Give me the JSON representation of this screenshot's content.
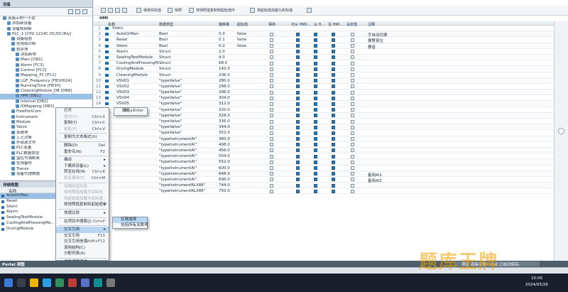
{
  "left_panel": {
    "title": "设备",
    "tree": [
      {
        "label": "连接示例一小试",
        "indent": 0
      },
      {
        "label": "添加新设备",
        "indent": 1
      },
      {
        "label": "设备和网络",
        "indent": 1
      },
      {
        "label": "PLC_1 [CPU 1214C DC/DC/Rly]",
        "indent": 1
      },
      {
        "label": "设备组态",
        "indent": 2
      },
      {
        "label": "在线和诊断",
        "indent": 2
      },
      {
        "label": "程序块",
        "indent": 2
      },
      {
        "label": "添加新块",
        "indent": 3
      },
      {
        "label": "Main [OB1]",
        "indent": 3
      },
      {
        "label": "Alarm [FC3]",
        "indent": 3
      },
      {
        "label": "Control [FC2]",
        "indent": 3
      },
      {
        "label": "Mapping_FC [FC1]",
        "indent": 3
      },
      {
        "label": "LGF_Frequency [FB10624]",
        "indent": 3
      },
      {
        "label": "RunningTime [FB30]",
        "indent": 3
      },
      {
        "label": "CleaningModule_DB [DB8]",
        "indent": 3
      },
      {
        "label": "HMI [DB1]",
        "indent": 3,
        "selected": true
      },
      {
        "label": "Interval [DB2]",
        "indent": 3
      },
      {
        "label": "IOMapping [DB3]",
        "indent": 3
      },
      {
        "label": "FreePortCom",
        "indent": 2
      },
      {
        "label": "Instrument",
        "indent": 2
      },
      {
        "label": "Module",
        "indent": 2
      },
      {
        "label": "Valve",
        "indent": 2
      },
      {
        "label": "系统块",
        "indent": 2
      },
      {
        "label": "工艺对象",
        "indent": 2
      },
      {
        "label": "外部源文件",
        "indent": 2
      },
      {
        "label": "PLC变量",
        "indent": 2
      },
      {
        "label": "PLC数据类型",
        "indent": 2
      },
      {
        "label": "监控与强制表",
        "indent": 2
      },
      {
        "label": "在线备份",
        "indent": 2
      },
      {
        "label": "Traces",
        "indent": 2
      },
      {
        "label": "设备代理数据",
        "indent": 2
      }
    ]
  },
  "detail_view": {
    "title": "详细视图",
    "column_header": "名称",
    "rows": [
      "AutoOrMan",
      "Reset",
      "Silent",
      "Alarm",
      "SealingTestModule",
      "CoolingAndPressingMe...",
      "DryingModule"
    ]
  },
  "toolbar": {
    "buttons": [
      "保持实际值",
      "快照",
      "将快照值复制到起始值中",
      "将起始值加载为实际值"
    ],
    "block_name": "HMI"
  },
  "grid": {
    "headers": [
      "名称",
      "数据类型",
      "偏移量",
      "起始值",
      "保持",
      "可从 HMI/...",
      "从 H...",
      "在 HMI...",
      "设定值",
      "注释"
    ],
    "rows": [
      {
        "n": "1",
        "name": "Static",
        "type": "",
        "offset": "",
        "start": "",
        "comment": "",
        "level": 0,
        "checks": [
          0,
          0,
          0,
          0,
          0
        ]
      },
      {
        "n": "2",
        "name": "AutoOrMan",
        "type": "Bool",
        "offset": "0.0",
        "start": "false",
        "comment": "手自动切换",
        "level": 1,
        "checks": [
          0,
          1,
          1,
          1,
          0
        ]
      },
      {
        "n": "3",
        "name": "Reset",
        "type": "Bool",
        "offset": "0.1",
        "start": "false",
        "comment": "报警复位",
        "level": 1,
        "checks": [
          0,
          1,
          1,
          1,
          0
        ]
      },
      {
        "n": "4",
        "name": "Silent",
        "type": "Bool",
        "offset": "0.2",
        "start": "false",
        "comment": "静音",
        "level": 1,
        "checks": [
          0,
          1,
          1,
          1,
          0
        ]
      },
      {
        "n": "5",
        "name": "Alarm",
        "type": "Struct",
        "offset": "2.0",
        "start": "",
        "comment": "",
        "level": 1,
        "checks": [
          0,
          1,
          1,
          1,
          0
        ]
      },
      {
        "n": "6",
        "name": "SealingTestModule",
        "type": "Struct",
        "offset": "4.0",
        "start": "",
        "comment": "",
        "level": 1,
        "checks": [
          0,
          1,
          1,
          1,
          0
        ]
      },
      {
        "n": "7",
        "name": "CoolingAndPressingM...",
        "type": "Struct",
        "offset": "68.0",
        "start": "",
        "comment": "",
        "level": 1,
        "checks": [
          0,
          1,
          1,
          1,
          0
        ]
      },
      {
        "n": "8",
        "name": "DryingModule",
        "type": "Struct",
        "offset": "142.0",
        "start": "",
        "comment": "",
        "level": 1,
        "checks": [
          0,
          1,
          1,
          1,
          0
        ]
      },
      {
        "n": "9",
        "name": "CleaningModule",
        "type": "Struct",
        "offset": "206.0",
        "start": "",
        "comment": "",
        "level": 1,
        "checks": [
          0,
          1,
          1,
          1,
          0
        ]
      },
      {
        "n": "10",
        "name": "VSV01",
        "type": "\"typeValve\"",
        "offset": "280.0",
        "start": "",
        "comment": "",
        "level": 1,
        "checks": [
          0,
          1,
          1,
          1,
          0
        ]
      },
      {
        "n": "11",
        "name": "VSV02",
        "type": "\"typeValve\"",
        "offset": "288.0",
        "start": "",
        "comment": "",
        "level": 1,
        "checks": [
          0,
          1,
          1,
          1,
          0
        ]
      },
      {
        "n": "12",
        "name": "VSV03",
        "type": "\"typeValve\"",
        "offset": "296.0",
        "start": "",
        "comment": "",
        "level": 1,
        "checks": [
          0,
          1,
          1,
          1,
          0
        ]
      },
      {
        "n": "13",
        "name": "VSV04",
        "type": "\"typeValve\"",
        "offset": "304.0",
        "start": "",
        "comment": "",
        "level": 1,
        "checks": [
          0,
          1,
          1,
          1,
          0
        ]
      },
      {
        "n": "14",
        "name": "VSV05",
        "type": "\"typeValve\"",
        "offset": "312.0",
        "start": "",
        "comment": "",
        "level": 1,
        "checks": [
          0,
          1,
          1,
          1,
          0
        ]
      },
      {
        "n": "15",
        "name": "",
        "type": "\"typeValve\"",
        "offset": "320.0",
        "start": "",
        "comment": "",
        "level": 1,
        "checks": [
          0,
          1,
          1,
          1,
          0
        ]
      },
      {
        "n": "16",
        "name": "",
        "type": "\"typeValve\"",
        "offset": "328.0",
        "start": "",
        "comment": "",
        "level": 1,
        "checks": [
          0,
          1,
          1,
          1,
          0
        ]
      },
      {
        "n": "17",
        "name": "",
        "type": "\"typeValve\"",
        "offset": "336.0",
        "start": "",
        "comment": "",
        "level": 1,
        "checks": [
          0,
          1,
          1,
          1,
          0
        ]
      },
      {
        "n": "18",
        "name": "",
        "type": "\"typeValve\"",
        "offset": "344.0",
        "start": "",
        "comment": "",
        "level": 1,
        "checks": [
          0,
          1,
          1,
          1,
          0
        ]
      },
      {
        "n": "19",
        "name": "",
        "type": "\"typeValve\"",
        "offset": "352.0",
        "start": "",
        "comment": "",
        "level": 1,
        "checks": [
          0,
          1,
          1,
          1,
          0
        ]
      },
      {
        "n": "20",
        "name": "",
        "type": "\"typeInstrumentAI\"",
        "offset": "360.0",
        "start": "",
        "comment": "",
        "level": 1,
        "checks": [
          0,
          1,
          1,
          1,
          0
        ]
      },
      {
        "n": "21",
        "name": "",
        "type": "\"typeInstrumentAI\"",
        "offset": "408.0",
        "start": "",
        "comment": "",
        "level": 1,
        "checks": [
          0,
          1,
          1,
          1,
          0
        ]
      },
      {
        "n": "22",
        "name": "",
        "type": "\"typeInstrumentAI\"",
        "offset": "456.0",
        "start": "",
        "comment": "",
        "level": 1,
        "checks": [
          0,
          1,
          1,
          1,
          0
        ]
      },
      {
        "n": "23",
        "name": "",
        "type": "\"typeInstrumentAI\"",
        "offset": "504.0",
        "start": "",
        "comment": "",
        "level": 1,
        "checks": [
          0,
          1,
          1,
          1,
          0
        ]
      },
      {
        "n": "24",
        "name": "",
        "type": "\"typeInstrumentAI\"",
        "offset": "552.0",
        "start": "",
        "comment": "",
        "level": 1,
        "checks": [
          0,
          1,
          1,
          1,
          0
        ]
      },
      {
        "n": "25",
        "name": "",
        "type": "\"typeInstrumentAI\"",
        "offset": "600.0",
        "start": "",
        "comment": "",
        "level": 1,
        "checks": [
          0,
          1,
          1,
          1,
          0
        ]
      },
      {
        "n": "26",
        "name": "",
        "type": "\"typeInstrumentAI\"",
        "offset": "648.0",
        "start": "",
        "comment": "备用AI1",
        "level": 1,
        "checks": [
          0,
          1,
          1,
          1,
          0
        ]
      },
      {
        "n": "27",
        "name": "",
        "type": "\"typeInstrumentAI\"",
        "offset": "696.0",
        "start": "",
        "comment": "备用AI2",
        "level": 1,
        "checks": [
          0,
          1,
          1,
          1,
          0
        ]
      },
      {
        "n": "28",
        "name": "",
        "type": "\"typeInstrumentRLX86\"",
        "offset": "744.0",
        "start": "",
        "comment": "",
        "level": 1,
        "checks": [
          0,
          1,
          1,
          1,
          0
        ]
      },
      {
        "n": "29",
        "name": "",
        "type": "\"typeInstrumentRLX86\"",
        "offset": "750.0",
        "start": "",
        "comment": "",
        "level": 1,
        "checks": [
          0,
          1,
          1,
          1,
          0
        ]
      }
    ]
  },
  "context_menu": {
    "items": [
      {
        "label": "打开",
        "shortcut": "",
        "disabled": false,
        "sep_after": false
      },
      {
        "label": "剪切(T)",
        "shortcut": "Ctrl+X",
        "disabled": true,
        "sep_after": false
      },
      {
        "label": "复制(Y)",
        "shortcut": "Ctrl+C",
        "disabled": false,
        "sep_after": false
      },
      {
        "label": "粘贴(P)",
        "shortcut": "Ctrl+V",
        "disabled": true,
        "sep_after": true
      },
      {
        "label": "复制为文本格式(X)",
        "shortcut": "",
        "disabled": false,
        "sep_after": true
      },
      {
        "label": "删除(D)",
        "shortcut": "Del",
        "disabled": false,
        "sep_after": false
      },
      {
        "label": "重命名(N)",
        "shortcut": "F2",
        "disabled": false,
        "sep_after": true
      },
      {
        "label": "编译",
        "shortcut": "",
        "disabled": false,
        "arrow": true,
        "sep_after": false
      },
      {
        "label": "下载到设备(L)",
        "shortcut": "",
        "disabled": false,
        "arrow": true,
        "sep_after": false
      },
      {
        "label": "转至在线(N)",
        "shortcut": "Ctrl+K",
        "disabled": false,
        "sep_after": false
      },
      {
        "label": "转至离线(F)",
        "shortcut": "Ctrl+M",
        "disabled": true,
        "sep_after": true
      },
      {
        "label": "快照的实际值",
        "shortcut": "",
        "disabled": true,
        "sep_after": false
      },
      {
        "label": "将快照值加载为实际值",
        "shortcut": "",
        "disabled": true,
        "sep_after": false
      },
      {
        "label": "将起始值加载为实际值",
        "shortcut": "",
        "disabled": true,
        "sep_after": false
      },
      {
        "label": "将快照值复制到起始值中",
        "shortcut": "",
        "disabled": false,
        "arrow": true,
        "sep_after": true
      },
      {
        "label": "快速比较",
        "shortcut": "",
        "disabled": false,
        "arrow": true,
        "sep_after": true
      },
      {
        "label": "在项目中搜索(J)",
        "shortcut": "Ctrl+F",
        "disabled": false,
        "sep_after": true
      },
      {
        "label": "交叉引用",
        "shortcut": "",
        "disabled": false,
        "selected": true,
        "arrow": true,
        "sep_after": false
      },
      {
        "label": "交叉引用",
        "shortcut": "F11",
        "disabled": false,
        "sep_after": false
      },
      {
        "label": "交叉引用信息",
        "shortcut": "Shift+F11",
        "disabled": false,
        "sep_after": false
      },
      {
        "label": "调用结构(C)",
        "shortcut": "",
        "disabled": false,
        "sep_after": false
      },
      {
        "label": "分配列表(A)",
        "shortcut": "",
        "disabled": false,
        "sep_after": true
      },
      {
        "label": "切换编程语言",
        "shortcut": "",
        "disabled": false,
        "arrow": true,
        "sep_after": true
      },
      {
        "label": "专有技术保护(K)",
        "shortcut": "",
        "disabled": false,
        "sep_after": true
      },
      {
        "label": "打印(P)...",
        "shortcut": "Ctrl+P",
        "disabled": false,
        "sep_after": false
      },
      {
        "label": "打印预览(V)...",
        "shortcut": "",
        "disabled": false,
        "sep_after": false
      }
    ]
  },
  "submenu_props": {
    "label": "属性...",
    "shortcut": "Alt+Enter"
  },
  "submenu_crossref": {
    "items": [
      "仅限选择",
      "包括所有关联项"
    ]
  },
  "portal": {
    "portal_label": "Portal 视图",
    "status_text": "项目 连接示例一小试 已成功保存。"
  },
  "taskbar": {
    "time": "10:09",
    "date": "2024/05/26"
  },
  "watermark": "题库王牌"
}
